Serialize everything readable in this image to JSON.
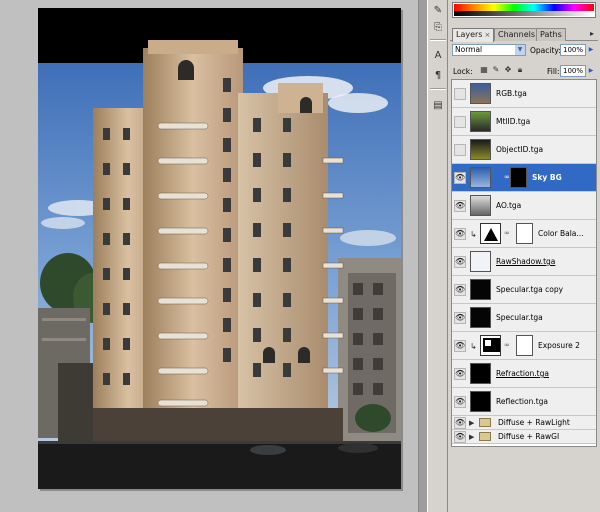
{
  "toolbar": {
    "icons": [
      "history-brush-icon",
      "clone-stamp-icon",
      "type-icon",
      "paragraph-icon",
      "info-icon"
    ]
  },
  "panel": {
    "tabs": [
      {
        "label": "Layers",
        "close": "×",
        "active": true
      },
      {
        "label": "Channels",
        "active": false
      },
      {
        "label": "Paths",
        "active": false
      }
    ],
    "blend_mode": "Normal",
    "opacity_label": "Opacity:",
    "opacity_value": "100%",
    "lock_label": "Lock:",
    "fill_label": "Fill:",
    "fill_value": "100%"
  },
  "layers": [
    {
      "name": "RGB.tga",
      "visible": false
    },
    {
      "name": "MtlID.tga",
      "visible": false
    },
    {
      "name": "ObjectID.tga",
      "visible": false
    },
    {
      "name": "Sky BG",
      "visible": true,
      "selected": true,
      "has_mask": true
    },
    {
      "name": "AO.tga",
      "visible": true
    },
    {
      "name": "Color Bala...",
      "visible": true,
      "adjustment": true,
      "clipped": true
    },
    {
      "name": "RawShadow.tga",
      "visible": true
    },
    {
      "name": "Specular.tga copy",
      "visible": true
    },
    {
      "name": "Specular.tga",
      "visible": true
    },
    {
      "name": "Exposure 2",
      "visible": true,
      "adjustment": true,
      "clipped": true
    },
    {
      "name": "Refraction.tga",
      "visible": true
    },
    {
      "name": "Reflection.tga",
      "visible": true
    },
    {
      "name": "Diffuse + RawLight",
      "visible": true,
      "group": true
    },
    {
      "name": "Diffuse + RawGI",
      "visible": true,
      "group": true
    }
  ],
  "colors": {
    "selection": "#316ac5",
    "panel_bg": "#d6d3ce",
    "canvas_bg": "#c0c0c0"
  }
}
